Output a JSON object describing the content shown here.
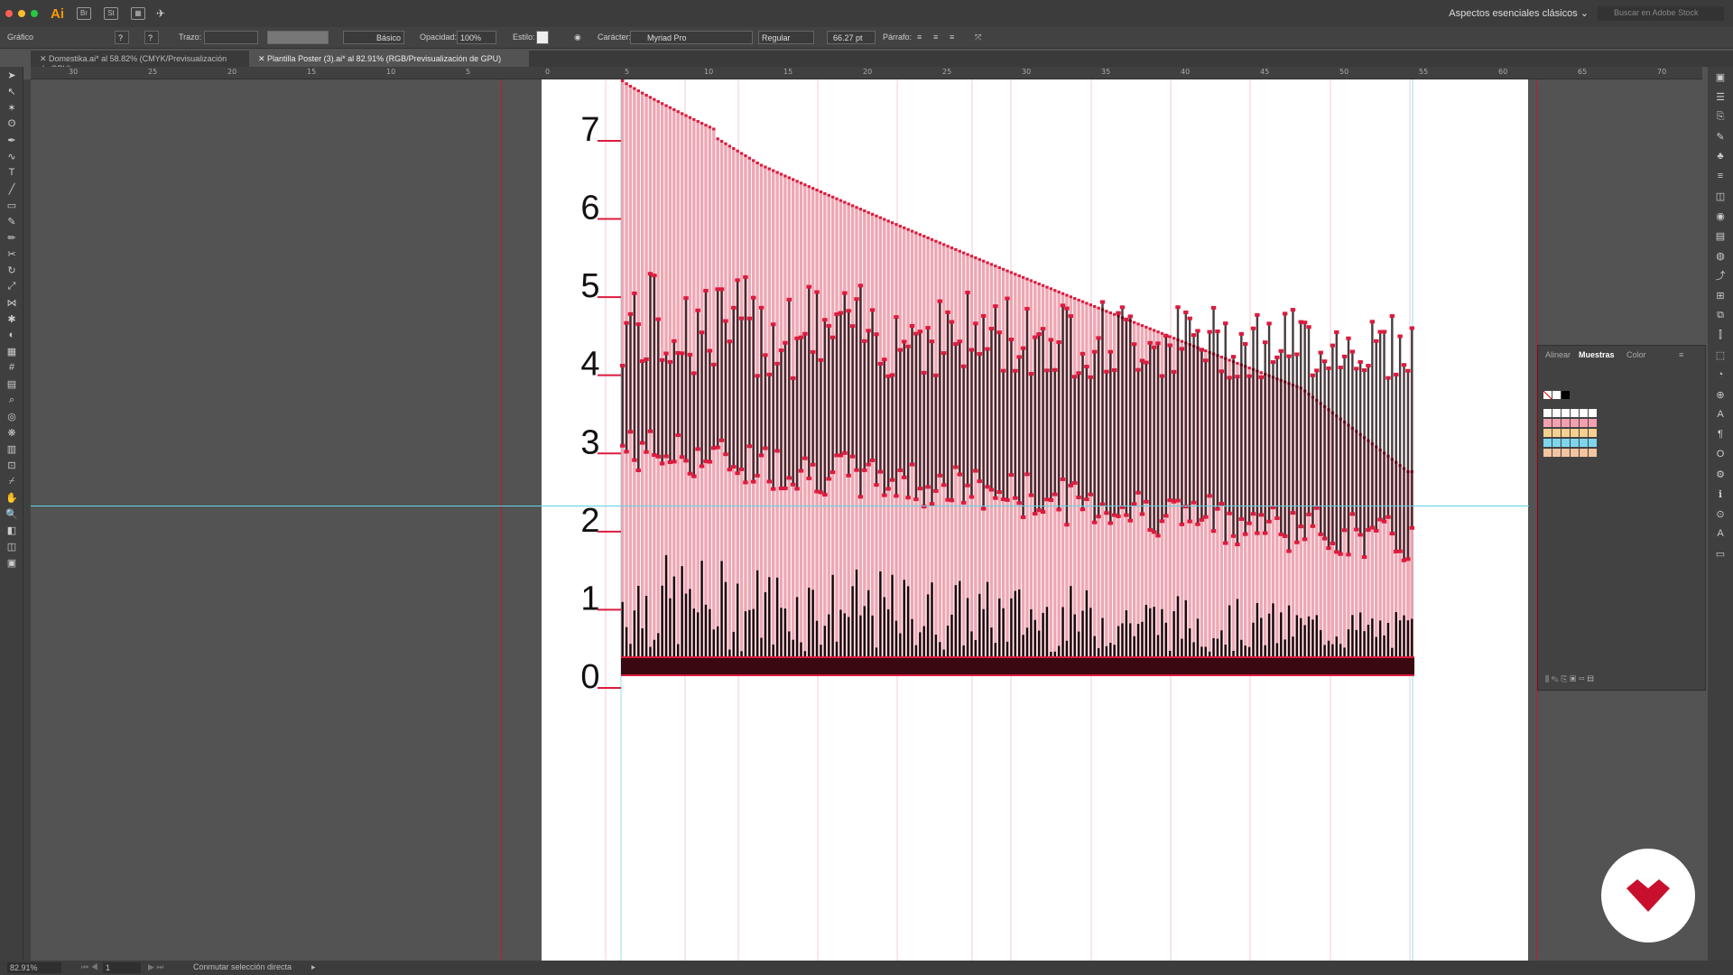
{
  "app": {
    "logo_text": "Ai",
    "bridge_label": "Br",
    "stock_label": "St",
    "workspace": "Aspectos esenciales clásicos",
    "stock_placeholder": "Buscar en Adobe Stock"
  },
  "controlbar": {
    "selection_type": "Gráfico",
    "stroke_label": "Trazo:",
    "stroke_style": "Básico",
    "opacity_label": "Opacidad:",
    "opacity_value": "100%",
    "style_label": "Estilo:",
    "character_label": "Carácter:",
    "font_family": "Myriad Pro",
    "font_style": "Regular",
    "font_size": "66.27 pt",
    "paragraph_label": "Párrafo:"
  },
  "tabs": [
    {
      "label": "Domestika.ai* al 58.82% (CMYK/Previsualización de GPU)",
      "active": false
    },
    {
      "label": "Plantilla Poster (3).ai* al 82.91% (RGB/Previsualización de GPU)",
      "active": true
    }
  ],
  "ruler": {
    "labels": [
      "30",
      "25",
      "20",
      "15",
      "10",
      "5",
      "0",
      "5",
      "10",
      "15",
      "20",
      "25",
      "30",
      "35",
      "40",
      "45",
      "50",
      "55",
      "60",
      "65",
      "70"
    ]
  },
  "chart_data": {
    "type": "bar",
    "y_ticks": [
      "0",
      "1",
      "2",
      "3",
      "4",
      "5",
      "6",
      "7"
    ],
    "ylim": [
      0,
      7.6
    ],
    "bar_count": 200,
    "upper_envelope": {
      "start": 7.6,
      "end": 3.3
    },
    "colors": {
      "bar_pink": "#e88a9a",
      "bar_dark": "#1a0b0e",
      "marker": "#dc1b3e"
    }
  },
  "panel": {
    "tabs": [
      "Alinear",
      "Muestras",
      "Color"
    ],
    "active_tab": "Muestras"
  },
  "status": {
    "zoom": "82.91%",
    "artboard": "1",
    "hint": "Conmutar selección directa"
  },
  "colors": {
    "accent": "#ff9a00",
    "chart_red": "#dc1b3e",
    "guide_cyan": "#5fd3e0",
    "badge_red": "#c8102e"
  }
}
